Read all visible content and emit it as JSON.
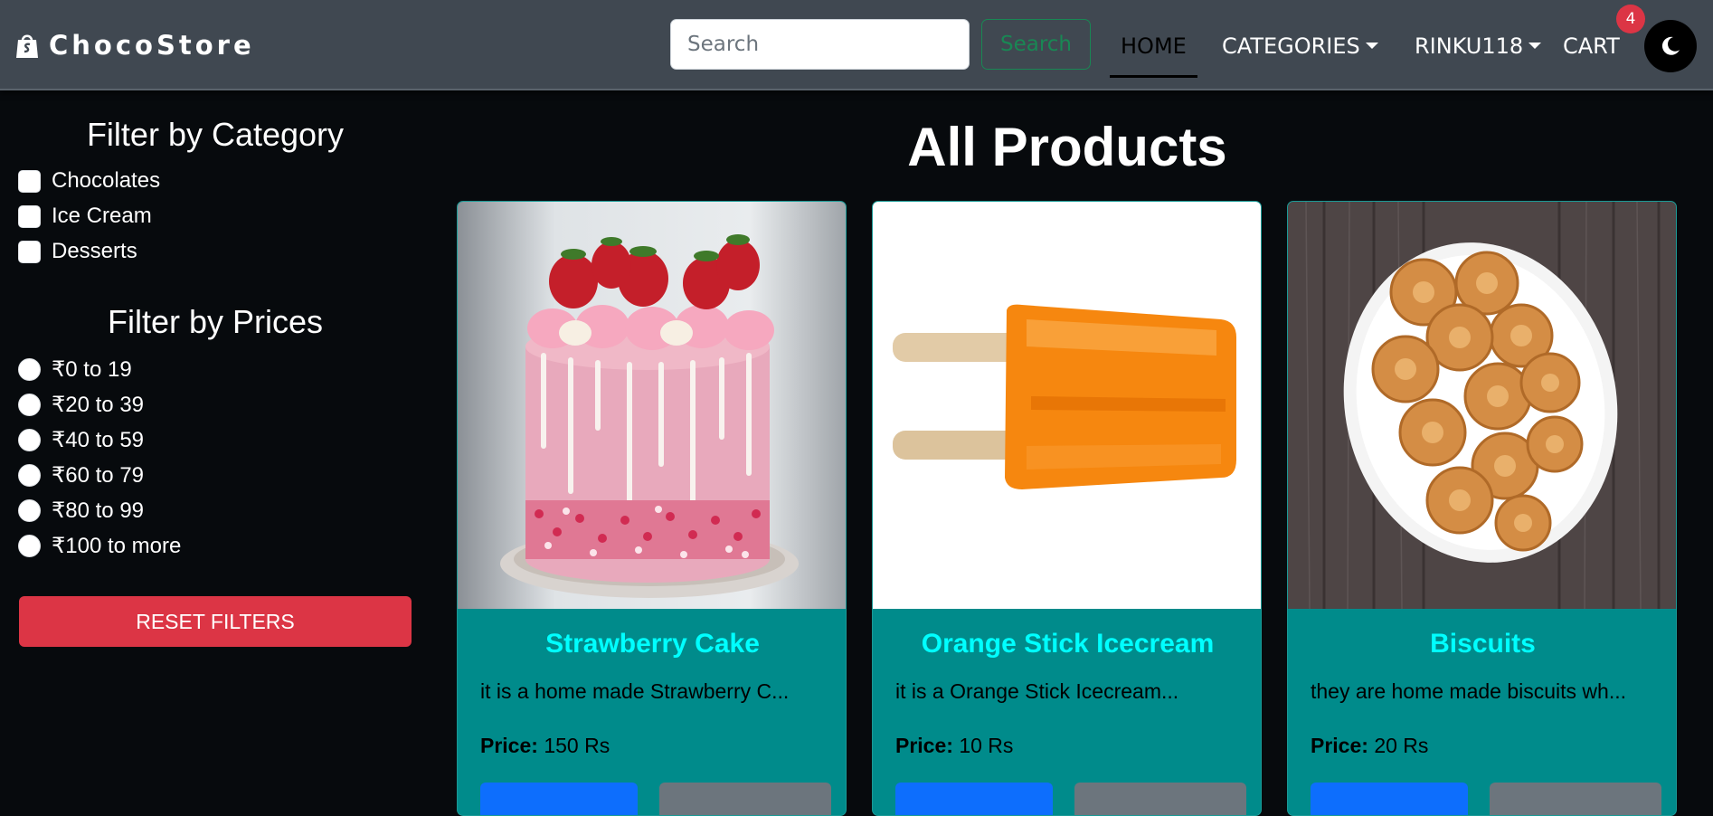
{
  "navbar": {
    "brand": "ChocoStore",
    "search_placeholder": "Search",
    "search_button": "Search",
    "links": {
      "home": "HOME",
      "categories": "CATEGORIES",
      "user": "RINKU118",
      "cart": "CART"
    },
    "cart_count": "4",
    "theme_icon": "moon-icon"
  },
  "sidebar": {
    "category_heading": "Filter by Category",
    "categories": [
      "Chocolates",
      "Ice Cream",
      "Desserts"
    ],
    "price_heading": "Filter by Prices",
    "prices": [
      "₹0 to 19",
      "₹20 to 39",
      "₹40 to 59",
      "₹60 to 79",
      "₹80 to 99",
      "₹100 to more"
    ],
    "reset_button": "RESET FILTERS"
  },
  "main": {
    "title": "All Products",
    "price_label": "Price:",
    "products": [
      {
        "name": "Strawberry Cake",
        "description": "it is a home made Strawberry C...",
        "price": "150 Rs",
        "image": "strawberry-cake-image"
      },
      {
        "name": "Orange Stick Icecream",
        "description": "it is a Orange Stick Icecream...",
        "price": "10 Rs",
        "image": "orange-popsicle-image"
      },
      {
        "name": "Biscuits",
        "description": "they are home made biscuits wh...",
        "price": "20 Rs",
        "image": "biscuits-plate-image"
      }
    ]
  },
  "colors": {
    "navbar_bg": "#404851",
    "page_bg": "#070a0d",
    "card_bg": "#008b8b",
    "card_title": "#00ffff",
    "reset_btn": "#dc3545",
    "search_btn": "#198754",
    "badge": "#dc3545"
  }
}
